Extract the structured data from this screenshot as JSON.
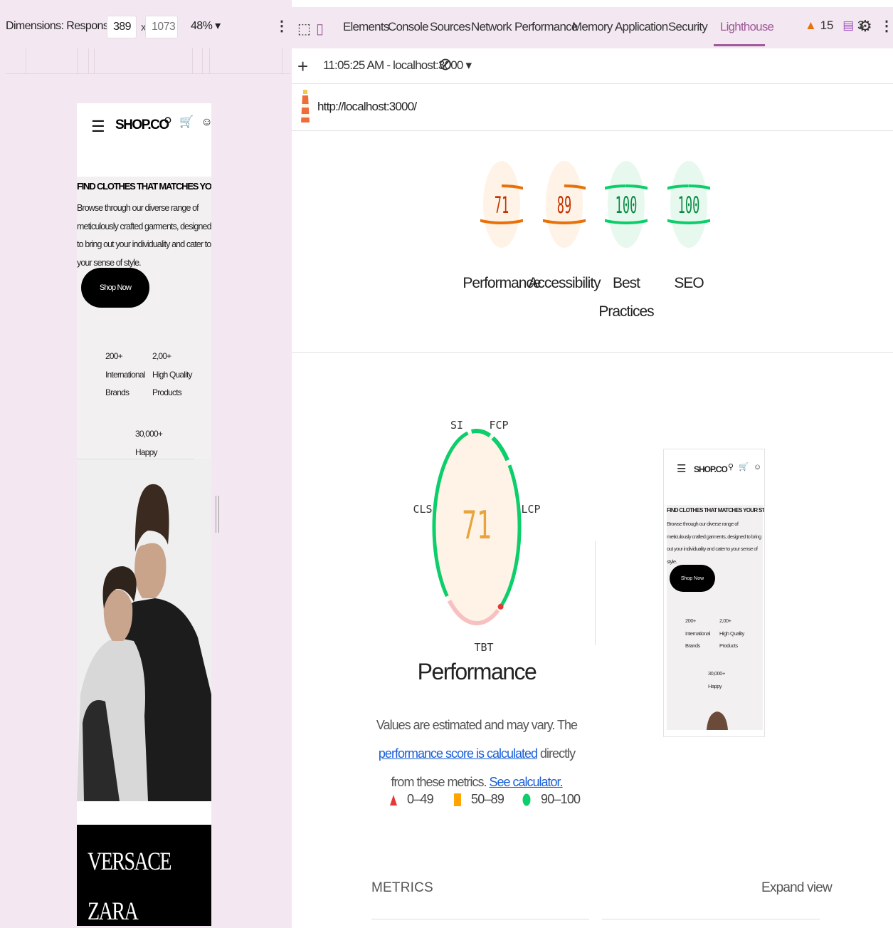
{
  "device_toolbar": {
    "dimensions_label": "Dimensions: Responsive ▾",
    "width_value": "389",
    "times": "x",
    "height_value": "1073",
    "zoom_label": "48% ▾",
    "menu_glyph": "⋮"
  },
  "phone": {
    "menu_glyph": "☰",
    "logo": "SHOP.CO",
    "icons": "⚲ 🛒 ☺",
    "hero_title": "FIND CLOTHES THAT MATCHES YOUR STYLE",
    "hero_desc": "Browse through our diverse range of meticulously crafted garments, designed to bring out your individuality and cater to your sense of style.",
    "cta": "Shop Now",
    "stats": [
      {
        "value": "200+",
        "label_line1": "International",
        "label_line2": "Brands"
      },
      {
        "value": "2,00+",
        "label_line1": "High Quality",
        "label_line2": "Products"
      },
      {
        "value": "30,000+",
        "label_line1": "Happy",
        "label_line2": ""
      }
    ],
    "brands": [
      "VERSACE",
      "ZARA"
    ]
  },
  "devtools": {
    "tabs": [
      "Elements",
      "Console",
      "Sources",
      "Network",
      "Performance",
      "Memory",
      "Application",
      "Security",
      "Lighthouse"
    ],
    "active_tab": "Lighthouse",
    "warning_count": "15",
    "message_count": "3",
    "inspect_icon": "⬚",
    "device_icon": "▯",
    "gear_glyph": "⚙",
    "kebab_glyph": "⋮"
  },
  "lighthouse": {
    "plus": "+",
    "report_select": "11:05:25 AM - localhost:3000 ▾",
    "clear_glyph": "⊘",
    "url": "http://localhost:3000/",
    "scores": [
      {
        "label": "Performance",
        "value": 71,
        "color": "#e8710a",
        "bg": "#fef3e6"
      },
      {
        "label": "Accessibility",
        "value": 89,
        "color": "#e8710a",
        "bg": "#fef3e6"
      },
      {
        "label": "Best Practices",
        "value": 100,
        "color": "#0cce6b",
        "bg": "#e7f9ee",
        "text_color": "#088a44"
      },
      {
        "label": "SEO",
        "value": 100,
        "color": "#0cce6b",
        "bg": "#e7f9ee",
        "text_color": "#088a44"
      }
    ],
    "main_gauge": {
      "score": 71,
      "metrics": [
        "SI",
        "FCP",
        "LCP",
        "TBT",
        "CLS"
      ],
      "title": "Performance"
    },
    "description_pre": "Values are estimated and may vary. The ",
    "link1": "performance score is calculated",
    "description_mid": " directly from these metrics. ",
    "link2": "See calculator.",
    "legend": [
      {
        "range": "0–49",
        "color": "#e53935",
        "shape": "triangle"
      },
      {
        "range": "50–89",
        "color": "#ffa400",
        "shape": "square"
      },
      {
        "range": "90–100",
        "color": "#0cce6b",
        "shape": "circle"
      }
    ],
    "thumbnail": {
      "logo": "SHOP.CO",
      "icons": "⚲ 🛒 ☺",
      "menu_glyph": "☰",
      "hero_title": "FIND CLOTHES THAT MATCHES YOUR STYLE",
      "hero_desc": "Browse through our diverse range of meticulously crafted garments, designed to bring out your individuality and cater to your sense of style.",
      "cta": "Shop Now",
      "stats": [
        {
          "value": "200+",
          "label_line1": "International",
          "label_line2": "Brands"
        },
        {
          "value": "2,00+",
          "label_line1": "High Quality",
          "label_line2": "Products"
        },
        {
          "value": "30,000+",
          "label_line1": "Happy",
          "label_line2": ""
        }
      ]
    },
    "metrics_heading": "METRICS",
    "expand_view": "Expand view"
  }
}
